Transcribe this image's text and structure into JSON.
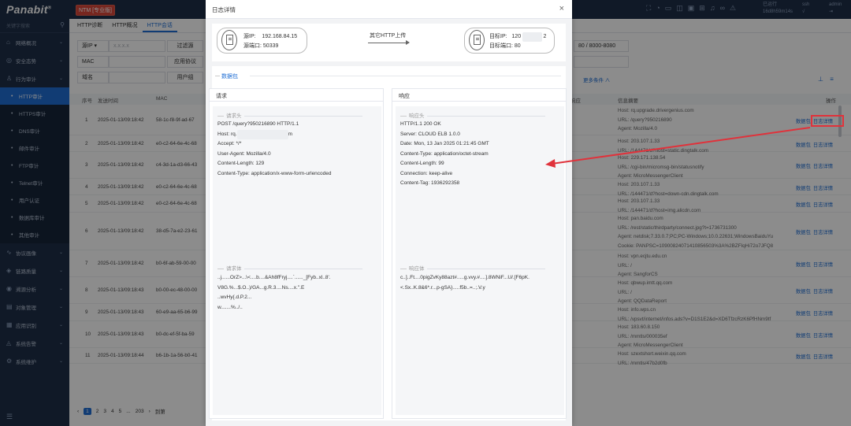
{
  "topbar": {
    "logo": "Panabit",
    "product": "NTM [专业版]",
    "icons": [
      "fullscreen-icon",
      "chat-icon",
      "monitor-icon",
      "layout-icon",
      "apps-icon",
      "grid-icon",
      "bell-icon",
      "link-icon",
      "alert-icon"
    ],
    "status_line1": "已运行",
    "status_line2": "16d8h59m14s",
    "user_line1": "ssh",
    "user_line2": "√",
    "admin_line1": "admin",
    "admin_line2": "⇥"
  },
  "sidebar": {
    "search_placeholder": "关键字搜索",
    "menu_top": [
      {
        "icon": "⌂",
        "label": "网络概况"
      },
      {
        "icon": "◎",
        "label": "安全态势"
      },
      {
        "icon": "♙",
        "label": "行为审计"
      }
    ],
    "submenu": [
      {
        "label": "HTTP审计",
        "active": true
      },
      {
        "label": "HTTPS审计"
      },
      {
        "label": "DNS审计"
      },
      {
        "label": "邮件审计"
      },
      {
        "label": "FTP审计"
      },
      {
        "label": "Telnet审计"
      },
      {
        "label": "用户认证"
      },
      {
        "label": "数据库审计"
      },
      {
        "label": "其他审计"
      }
    ],
    "menu_bottom": [
      {
        "icon": "∿",
        "label": "协议画像"
      },
      {
        "icon": "◈",
        "label": "链路质量"
      },
      {
        "icon": "◉",
        "label": "溯源分析"
      },
      {
        "icon": "▤",
        "label": "对象管理"
      },
      {
        "icon": "▦",
        "label": "应用识别"
      },
      {
        "icon": "◬",
        "label": "系统告警"
      },
      {
        "icon": "⚙",
        "label": "系统维护"
      }
    ]
  },
  "main": {
    "tabs": [
      "HTTP诊断",
      "HTTP概况",
      "HTTP会话"
    ],
    "filters": {
      "src_ip_select": "源IP",
      "src_ip_placeholder": "x.x.x.x",
      "filter_button": "过滤源",
      "mac_label": "MAC",
      "app_proto_button": "应用协议",
      "domain_label": "域名",
      "user_button": "用户组",
      "port_range": "80 / 8000-8080",
      "more": "更多条件 ∧"
    },
    "columns": {
      "seq": "序号",
      "time": "发送时间",
      "mac": "MAC",
      "resp": "响应",
      "info": "信息摘要",
      "ops": "操作"
    },
    "op_packet": "数据包",
    "op_detail": "日志详情",
    "rows": [
      {
        "seq": "1",
        "time": "2025-01-13/09:18:42",
        "mac": "58-1c-f8-9f-ad-67",
        "info": [
          "Host: rq.upgrade.drivergenius.com",
          "URL: /query?950216890",
          "Agent: Mozilla/4.0"
        ]
      },
      {
        "seq": "2",
        "time": "2025-01-13/09:18:42",
        "mac": "e0-c2-64-6e-4c-68",
        "info": [
          "Host: 203.107.1.33",
          "URL: /144471/d?host=static.dingtalk.com"
        ]
      },
      {
        "seq": "3",
        "time": "2025-01-13/09:18:42",
        "mac": "c4-3d-1a-d3-66-43",
        "info": [
          "Host: 229.171.138.54",
          "URL: /cgi-bin/micromsg-bin/statusnotify",
          "Agent: MicroMessengerClient"
        ]
      },
      {
        "seq": "4",
        "time": "2025-01-13/09:18:42",
        "mac": "e0-c2-64-6e-4c-68",
        "info": [
          "Host: 203.107.1.33",
          "URL: /144471/d?host=down-cdn.dingtalk.com"
        ]
      },
      {
        "seq": "5",
        "time": "2025-01-13/09:18:42",
        "mac": "e0-c2-64-6e-4c-68",
        "info": [
          "Host: 203.107.1.33",
          "URL: /144471/d?host=img.alicdn.com"
        ]
      },
      {
        "seq": "6",
        "time": "2025-01-13/09:18:42",
        "mac": "38-d5-7a-e2-23-61",
        "info": [
          "Host: pan.baidu.com",
          "URL: /rest/static/thirdparty/connect.jpg?t=1736731300",
          "Agent: netdisk;7.33.0.7;PC;PC-Windows;10.0.22631;WindowsBaiduYu",
          "Cookie: PANPSC=10900824071410856503%3A%2BZFIqHi72o7JFQ8"
        ]
      },
      {
        "seq": "7",
        "time": "2025-01-13/09:18:42",
        "mac": "b0-6f-ab-59-00-00",
        "info": [
          "Host: vpn.ecjtu.edu.cn",
          "URL: /",
          "Agent: SangforCS"
        ]
      },
      {
        "seq": "8",
        "time": "2025-01-13/09:18:43",
        "mac": "b0-00-ec-48-00-00",
        "info": [
          "Host: qbwup.imtt.qq.com",
          "URL: /",
          "Agent: QQDataReport"
        ]
      },
      {
        "seq": "9",
        "time": "2025-01-13/09:18:43",
        "mac": "60-e9-aa-65-b6-99",
        "info": [
          "Host: info.wps.cn",
          "URL: /vpsvt/internet/infos.ads?v=D1S1E2&d=XD6TfzcRzK6PfHNm9tf"
        ]
      },
      {
        "seq": "10",
        "time": "2025-01-13/09:18:43",
        "mac": "b0-dc-ef-5f-ba-59",
        "info": [
          "Host: 183.60.8.150",
          "URL: /mmtls/000035ef",
          "Agent: MicroMessengerClient"
        ]
      },
      {
        "seq": "11",
        "time": "2025-01-13/09:18:44",
        "mac": "b6-1b-1a-56-b0-41",
        "info": [
          "Host: szextshort.weixin.qq.com",
          "URL: /mmtls/47b2d0fb"
        ]
      }
    ],
    "pager": {
      "prev": "‹",
      "pages": [
        "1",
        "2",
        "3",
        "4",
        "5",
        "...",
        "203"
      ],
      "next": "›",
      "goto": "到第"
    }
  },
  "modal": {
    "title": "日志详情",
    "close": "×",
    "flow": {
      "src_ip_label": "源IP:",
      "src_ip": "192.168.84.15",
      "src_port_label": "源端口:",
      "src_port": "50339",
      "proto": "其它HTTP上传",
      "dst_ip_label": "目标IP:",
      "dst_ip_prefix": "120",
      "dst_ip_suffix": "2",
      "dst_port_label": "目标端口:",
      "dst_port": "80"
    },
    "packet_title": "数据包",
    "request": {
      "title": "请求",
      "header_label": "请求头",
      "header_lines": [
        "POST /query?950216890 HTTP/1.1",
        "Host: rq.",
        "Accept: */*",
        "User-Agent: Mozilla/4.0",
        "Content-Length: 129",
        "Content-Type: application/x-www-form-urlencoded"
      ],
      "host_suffix": "m",
      "body_label": "请求体",
      "body_lines": [
        "..j......OrZ>...\\<....b....&Ah8fFryj....`......_[Fyb..xl..8'.",
        "V8G.%...$.O..)/GA...g.R.3....Ns....x.\".E",
        "..wvHy{.d.P.2...",
        "w.......%../.."
      ]
    },
    "response": {
      "title": "响应",
      "header_label": "响应头",
      "header_lines": [
        "HTTP/1.1 200 OK",
        "Server: CLOUD ELB 1.0.0",
        "Date: Mon, 13 Jan 2025 01:21:45 GMT",
        "Content-Type: application/octet-stream",
        "Content-Length: 99",
        "Connection: keep-alive",
        "Content-Tag: 1936292358"
      ],
      "body_label": "响应体",
      "body_lines": [
        "c..]..Ft....0pigZvKy88azt#.....g.vvy.#....].8WNiF...U/.[F6pK.",
        "<.Sx..K.8&6*.r...p-gSA}.....f5b..=..;.V.y"
      ]
    }
  },
  "colors": {
    "accent": "#1f6ed4",
    "sidebar": "#1e2e47",
    "annotation": "#e0323b"
  }
}
